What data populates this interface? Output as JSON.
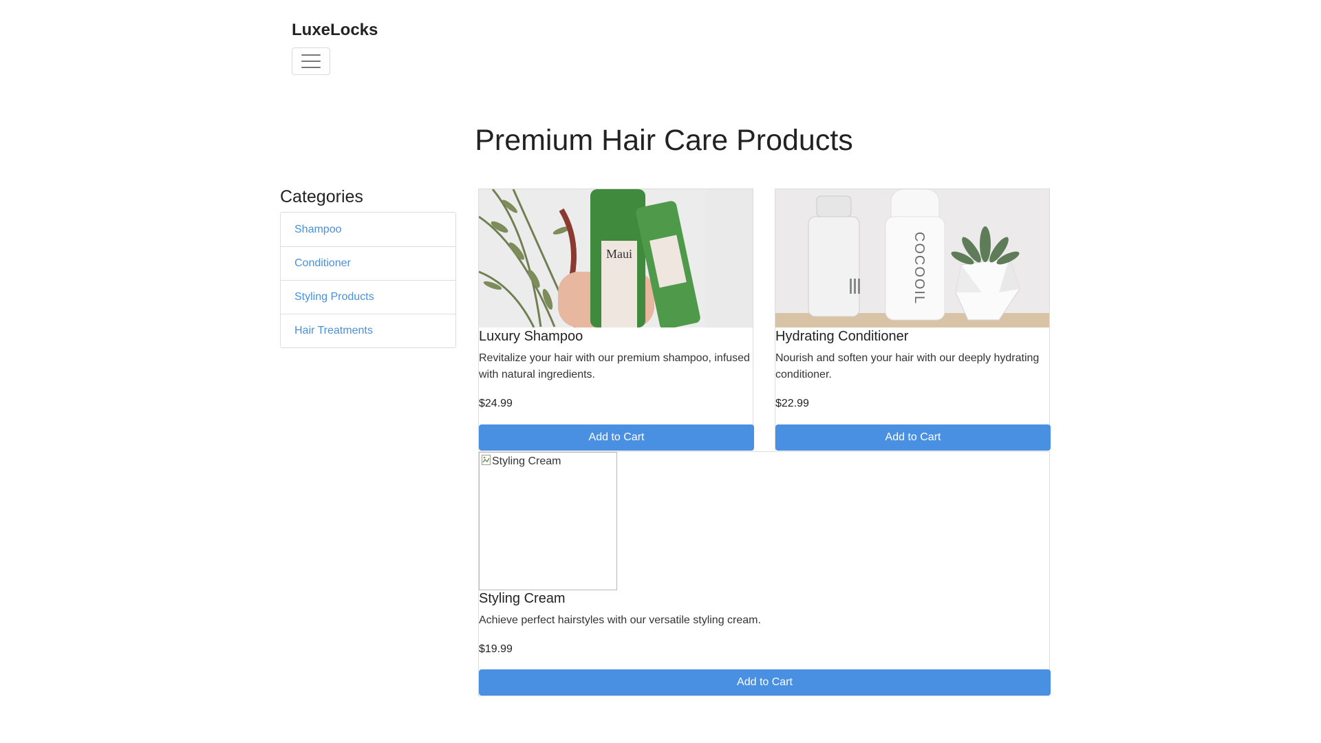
{
  "brand": "LuxeLocks",
  "page_title": "Premium Hair Care Products",
  "sidebar": {
    "title": "Categories",
    "items": [
      {
        "label": "Shampoo"
      },
      {
        "label": "Conditioner"
      },
      {
        "label": "Styling Products"
      },
      {
        "label": "Hair Treatments"
      }
    ]
  },
  "products": [
    {
      "title": "Luxury Shampoo",
      "description": "Revitalize your hair with our premium shampoo, infused with natural ingredients.",
      "price": "$24.99",
      "button_label": "Add to Cart",
      "image_alt": "Luxury Shampoo"
    },
    {
      "title": "Hydrating Conditioner",
      "description": "Nourish and soften your hair with our deeply hydrating conditioner.",
      "price": "$22.99",
      "button_label": "Add to Cart",
      "image_alt": "Hydrating Conditioner"
    },
    {
      "title": "Styling Cream",
      "description": "Achieve perfect hairstyles with our versatile styling cream.",
      "price": "$19.99",
      "button_label": "Add to Cart",
      "image_alt": "Styling Cream"
    }
  ],
  "colors": {
    "accent": "#4a90e2",
    "link": "#4a90d9"
  },
  "icons": {
    "menu": "hamburger-menu-icon",
    "broken_image": "broken-image-icon"
  }
}
